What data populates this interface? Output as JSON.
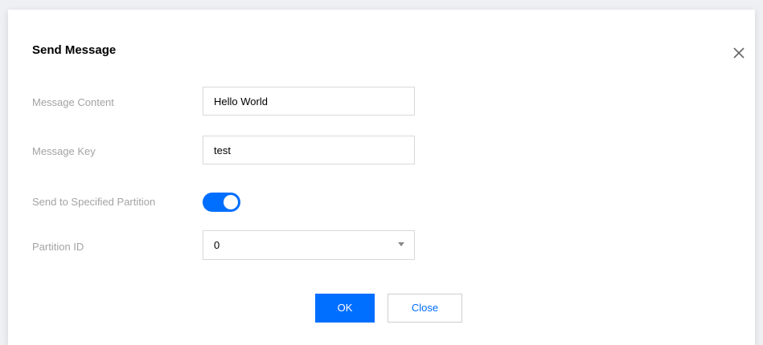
{
  "dialog": {
    "title": "Send Message",
    "close_icon": "close-icon"
  },
  "form": {
    "message_content": {
      "label": "Message Content",
      "value": "Hello World"
    },
    "message_key": {
      "label": "Message Key",
      "value": "test"
    },
    "send_to_partition": {
      "label": "Send to Specified Partition",
      "enabled": true
    },
    "partition_id": {
      "label": "Partition ID",
      "value": "0",
      "icon": "chevron-down-icon"
    }
  },
  "footer": {
    "ok_label": "OK",
    "close_label": "Close"
  },
  "colors": {
    "primary": "#006eff",
    "label": "#a3a3a3",
    "border": "#d9d9d9"
  }
}
